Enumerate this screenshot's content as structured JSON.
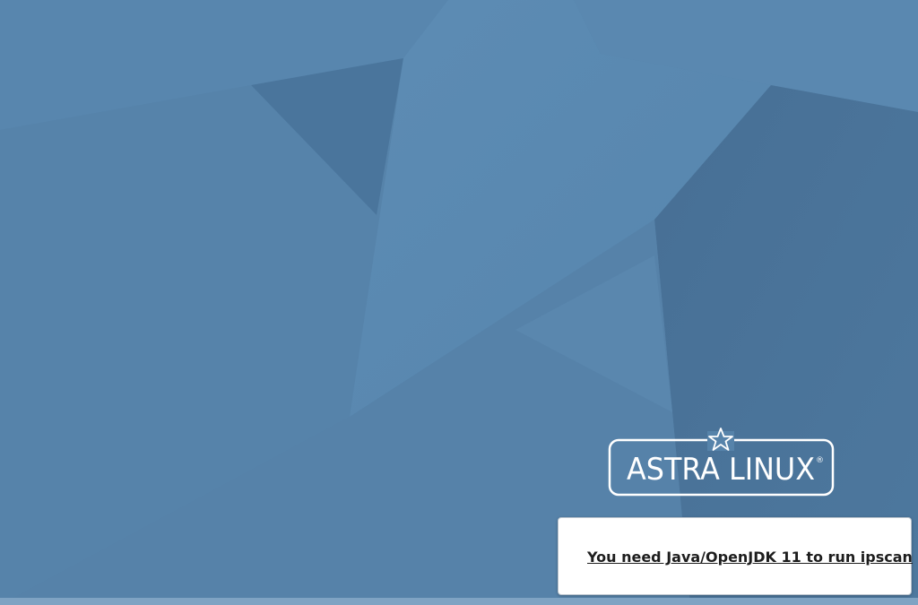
{
  "desktop": {
    "logo": {
      "text": "ASTRA LINUX",
      "registered_mark": "®"
    }
  },
  "notification": {
    "message": "You need Java/OpenJDK 11 to run ipscan"
  },
  "colors": {
    "wallpaper_base": "#5683aa",
    "wallpaper_light": "#5b8ab2",
    "wallpaper_dark": "#4a7499",
    "logo": "#ffffff",
    "notification_bg": "#ffffff",
    "notification_text": "#1d1d1d"
  }
}
